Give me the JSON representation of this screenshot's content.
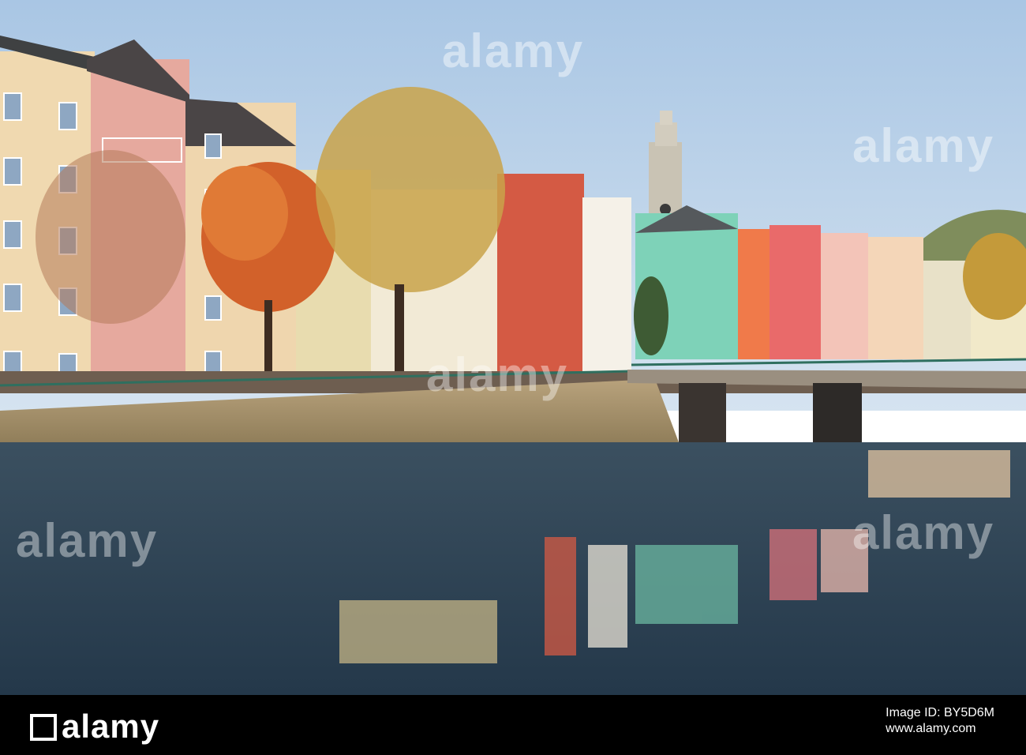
{
  "scene": {
    "description_visible": "",
    "sky_color": "#c4d8ec",
    "water_color": "#2d4a60"
  },
  "watermark": {
    "text": "alamy",
    "strip_logo": "alamy",
    "image_id_label": "Image ID: BY5D6M",
    "site_url": "www.alamy.com"
  },
  "colors": {
    "strip_background": "#000000"
  }
}
